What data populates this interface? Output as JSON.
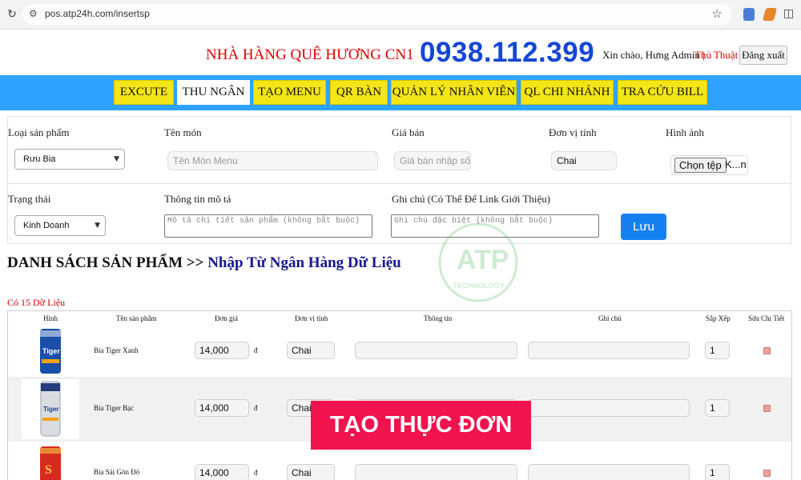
{
  "browser": {
    "url": "pos.atp24h.com/insertsp",
    "icons": [
      "reload-icon",
      "site-info-icon",
      "star-icon",
      "extension-icons"
    ]
  },
  "header": {
    "restaurant_name": "NHÀ HÀNG QUÊ HƯƠNG CN1",
    "phone": "0938.112.399",
    "greeting": "Xin chào, Hưng Admin |",
    "tips_link": "Thủ Thuật",
    "logout_label": "Đăng xuất"
  },
  "nav": {
    "items": [
      {
        "label": "EXCUTE"
      },
      {
        "label": "THU NGÂN",
        "active": true
      },
      {
        "label": "TẠO MENU"
      },
      {
        "label": "QR BÀN"
      },
      {
        "label": "QUẢN LÝ NHÂN VIÊN"
      },
      {
        "label": "QL CHI NHÁNH"
      },
      {
        "label": "TRA CỨU BILL"
      }
    ]
  },
  "form": {
    "product_type_label": "Loại sản phẩm",
    "product_type_value": "Rưu Bia",
    "dish_name_label": "Tên món",
    "dish_name_placeholder": "Tên Món Menu",
    "price_label": "Giá bán",
    "price_placeholder": "Giá bán nhập số k",
    "unit_label": "Đơn vị tính",
    "unit_value": "Chai",
    "image_label": "Hình ảnh",
    "file_button": "Chọn tệp",
    "file_name": "K...n",
    "status_label": "Trạng thái",
    "status_value": "Kinh Doanh",
    "description_label": "Thông tin mô tả",
    "description_placeholder": "Mô tả chi tiết sản phẩm (không bắt buộc)",
    "note_label": "Ghi chú (Có Thể Để Link Giới Thiệu)",
    "note_placeholder": "Ghi chú đặc biệt (không bắt buộc)",
    "save_label": "Lưu"
  },
  "watermark": {
    "text": "ATP",
    "subtext": "TECHNOLOGY"
  },
  "list": {
    "title": "DANH SÁCH SẢN PHẨM >> ",
    "link": "Nhập Từ Ngân Hàng Dữ Liệu",
    "count": "Có 15 Dữ Liệu",
    "columns": [
      "Hình",
      "Tên sản phẩm",
      "Đơn giá",
      "Đơn vị tính",
      "Thông tin",
      "Ghi chú",
      "Sắp Xếp",
      "Sửa Chi Tiết"
    ],
    "currency": "đ",
    "rows": [
      {
        "name": "Bia Tiger Xanh",
        "price": "14,000",
        "unit": "Chai",
        "order": "1"
      },
      {
        "name": "Bia Tiger Bạc",
        "price": "14,000",
        "unit": "Chai",
        "order": "1"
      },
      {
        "name": "Bia Sài Gòn Đỏ",
        "price": "14,000",
        "unit": "Chai",
        "order": "1"
      }
    ]
  },
  "banner": {
    "text": "TẠO THỰC ĐƠN"
  }
}
